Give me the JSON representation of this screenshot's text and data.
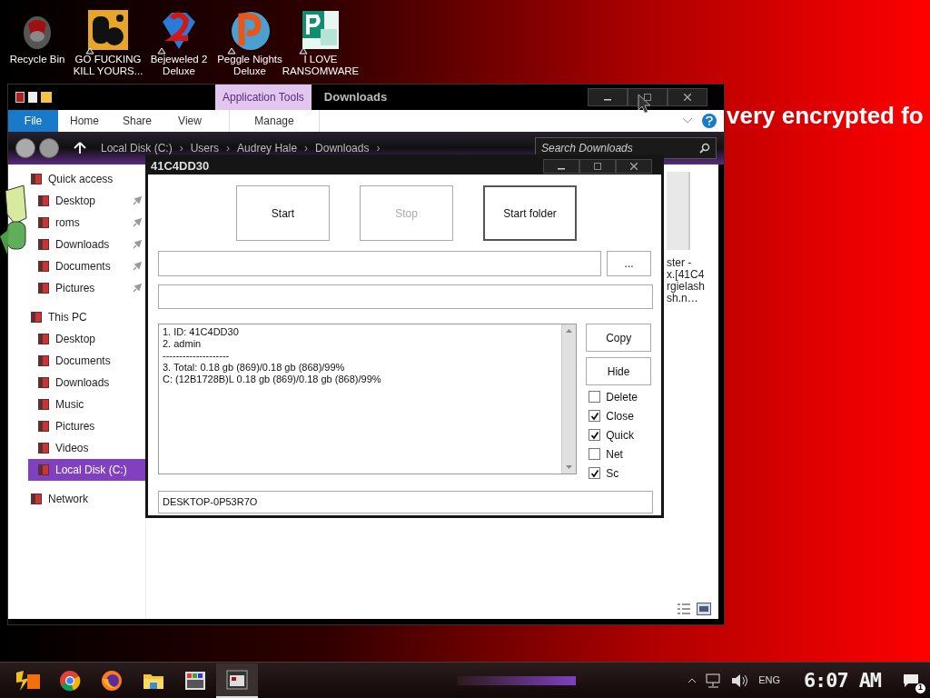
{
  "wallpaper": {
    "line_2": "very encrypted fo"
  },
  "desktop_icons": [
    {
      "label": "Recycle Bin",
      "shortcut": false
    },
    {
      "label": "GO FUCKING KILL YOURS...",
      "shortcut": true
    },
    {
      "label": "Bejeweled 2 Deluxe",
      "shortcut": true
    },
    {
      "label": "Peggle Nights Deluxe",
      "shortcut": true
    },
    {
      "label": "I LOVE RANSOMWARE",
      "shortcut": true
    }
  ],
  "explorer": {
    "title": "Downloads",
    "context_tab": "Application Tools",
    "ribbon_tabs": [
      {
        "label": "File",
        "kind": "file",
        "selected": false
      },
      {
        "label": "Home",
        "kind": "tab",
        "selected": false
      },
      {
        "label": "Share",
        "kind": "tab",
        "selected": false
      },
      {
        "label": "View",
        "kind": "tab",
        "selected": false
      },
      {
        "label": "Manage",
        "kind": "tab",
        "selected": false
      }
    ],
    "breadcrumb": [
      "Local Disk (C:)",
      "Users",
      "Audrey Hale",
      "Downloads"
    ],
    "breadcrumb_separator": "›",
    "search": {
      "placeholder": "Search Downloads"
    },
    "nav": [
      {
        "label": "Quick access",
        "selected": false,
        "children": [
          {
            "label": "Desktop",
            "pinned": true,
            "selected": false
          },
          {
            "label": "roms",
            "pinned": true,
            "selected": false
          },
          {
            "label": "Downloads",
            "pinned": true,
            "selected": false
          },
          {
            "label": "Documents",
            "pinned": true,
            "selected": false
          },
          {
            "label": "Pictures",
            "pinned": true,
            "selected": false
          }
        ]
      },
      {
        "label": "This PC",
        "selected": false,
        "children": [
          {
            "label": "Desktop",
            "pinned": false,
            "selected": false
          },
          {
            "label": "Documents",
            "pinned": false,
            "selected": false
          },
          {
            "label": "Downloads",
            "pinned": false,
            "selected": false
          },
          {
            "label": "Music",
            "pinned": false,
            "selected": false
          },
          {
            "label": "Pictures",
            "pinned": false,
            "selected": false
          },
          {
            "label": "Videos",
            "pinned": false,
            "selected": false
          },
          {
            "label": "Local Disk (C:)",
            "pinned": false,
            "selected": true
          }
        ]
      },
      {
        "label": "Network",
        "selected": false
      }
    ],
    "file_label": [
      "ster -",
      "x.[41C4",
      "rgielash",
      "sh.n…"
    ]
  },
  "dialog": {
    "title": "41C4DD30",
    "buttons": [
      {
        "label": "Start",
        "disabled": false,
        "default": false
      },
      {
        "label": "Stop",
        "disabled": true,
        "default": false
      },
      {
        "label": "Start folder",
        "disabled": false,
        "default": true
      }
    ],
    "browse": "...",
    "log": [
      "1. ID: 41C4DD30",
      "2. admin",
      "--------------------",
      "3. Total: 0.18 gb (869)/0.18 gb (868)/99%",
      "C: (12B1728B)L 0.18 gb (869)/0.18 gb (868)/99%"
    ],
    "side_buttons": [
      "Copy",
      "Hide"
    ],
    "options": [
      {
        "label": "Delete",
        "checked": false
      },
      {
        "label": "Close",
        "checked": true
      },
      {
        "label": "Quick",
        "checked": true
      },
      {
        "label": "Net",
        "checked": false
      },
      {
        "label": "Sc",
        "checked": true
      }
    ],
    "computer_name": "DESKTOP-0P53R7O"
  },
  "taskbar": {
    "apps": [
      {
        "active": false
      },
      {
        "active": false
      },
      {
        "active": false
      },
      {
        "active": false
      },
      {
        "active": false
      },
      {
        "active": true
      }
    ],
    "language": "ENG",
    "time": "6:07 AM",
    "notifications": "1"
  }
}
